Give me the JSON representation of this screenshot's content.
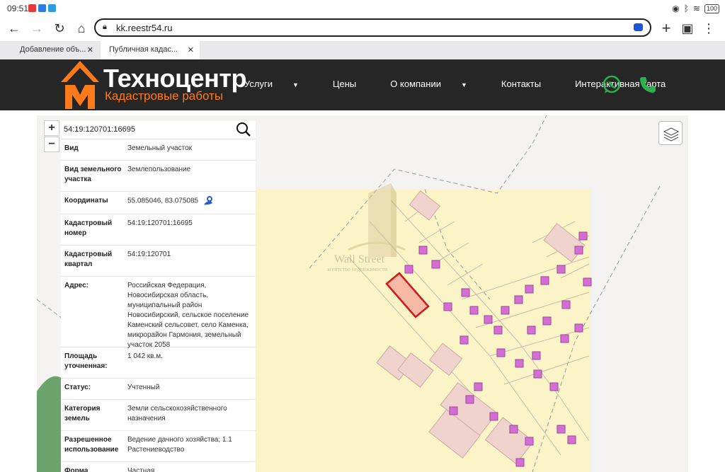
{
  "status_bar": {
    "time": "09:51",
    "battery": "100"
  },
  "browser": {
    "url": "kk.reestr54.ru",
    "tabs": [
      {
        "label": "Добавление объ...",
        "active": false
      },
      {
        "label": "Публичная кадас...",
        "active": true
      }
    ]
  },
  "site": {
    "brand": "Техноцентр",
    "subtitle": "Кадастровые работы",
    "nav": [
      {
        "label": "Услуги",
        "dropdown": true
      },
      {
        "label": "Цены",
        "dropdown": false
      },
      {
        "label": "О компании",
        "dropdown": true
      },
      {
        "label": "Контакты",
        "dropdown": false
      },
      {
        "label": "Интерактивная карта",
        "dropdown": false
      }
    ],
    "colors": {
      "header_bg": "#262626",
      "accent": "#ff7a1a",
      "whatsapp": "#2bb24c"
    }
  },
  "map": {
    "zoom_in": "+",
    "zoom_out": "−",
    "watermark_title": "Wall Street",
    "watermark_sub": "агентство недвижимости",
    "search_value": "54:19:120701:16695",
    "fields": [
      {
        "key": "Вид",
        "value": "Земельный участок"
      },
      {
        "key": "Вид земельного участка",
        "value": "Землепользование"
      },
      {
        "key": "Координаты",
        "value": "55.085046, 83.075085",
        "icon": "map-marker-icon"
      },
      {
        "key": "Кадастровый номер",
        "value": "54:19:120701:16695"
      },
      {
        "key": "Кадастровый квартал",
        "value": "54:19:120701"
      },
      {
        "key": "Адрес:",
        "value": "Российская Федерация, Новосибирская область, муниципальный район Новосибирский, сельское поселение Каменский сельсовет, село Каменка, микрорайон Гармония, земельный участок 2058"
      },
      {
        "key": "Площадь уточненная:",
        "value": "1 042 кв.м."
      },
      {
        "key": "Статус:",
        "value": "Учтенный"
      },
      {
        "key": "Категория земель",
        "value": "Земли сельскохозяйственного назначения"
      },
      {
        "key": "Разрешенное использование",
        "value": "Ведение дачного хозяйства; 1.1 Растениеводство"
      },
      {
        "key": "Форма",
        "value": "Частная"
      }
    ]
  }
}
